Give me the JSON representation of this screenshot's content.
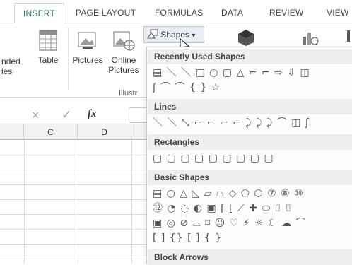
{
  "tabs": [
    "INSERT",
    "PAGE LAYOUT",
    "FORMULAS",
    "DATA",
    "REVIEW",
    "VIEW"
  ],
  "ribbon": {
    "recommended_pivot": "nded",
    "recommended_pivot_line2": "les",
    "table": "Table",
    "pictures": "Pictures",
    "online_pictures": "Online",
    "online_pictures_line2": "Pictures",
    "illustrations_group": "Illustr",
    "shapes_button": "Shapes",
    "shapes_caret": "▾"
  },
  "formula_bar": {
    "cancel": "×",
    "enter": "✓",
    "fx": "fx"
  },
  "columns": [
    "C",
    "D"
  ],
  "shapes_panel": {
    "sections": [
      {
        "title": "Recently Used Shapes",
        "rows": [
          "▤ ＼ ＼ □ ○ ▢ △ ⌐ ⌐ ⇨ ⇩ ◫",
          "ʃ ⌒ ⌒ { } ☆"
        ]
      },
      {
        "title": "Lines",
        "rows": [
          "＼ ＼ ⤡ ⌐ ⌐ ⌐ ⌐ ⤸ ⤸ ⤸ ⌒ ◫ ʃ"
        ]
      },
      {
        "title": "Rectangles",
        "rows": [
          "▢ ▢ ▢ ▢ ▢ ▢ ▢ ▢ ▢"
        ]
      },
      {
        "title": "Basic Shapes",
        "rows": [
          "▤ ○ △ ◺ ▱ ⏢ ◇ ⬠ ⬡ ⑦ ⑧ ⑩",
          "⑫ ◔ ◌ ◐ ▣ ⌈ ⌊ ⟋ ✚ ⬭ ⌷ ⌷",
          "▣ ◎ ⊘ ⌓ ⌑ ☺ ♡ ⚡ ☼ ☾ ☁ ⌒",
          "[ ] {} [ ] { }"
        ]
      },
      {
        "title": "Block Arrows",
        "rows": []
      }
    ]
  }
}
